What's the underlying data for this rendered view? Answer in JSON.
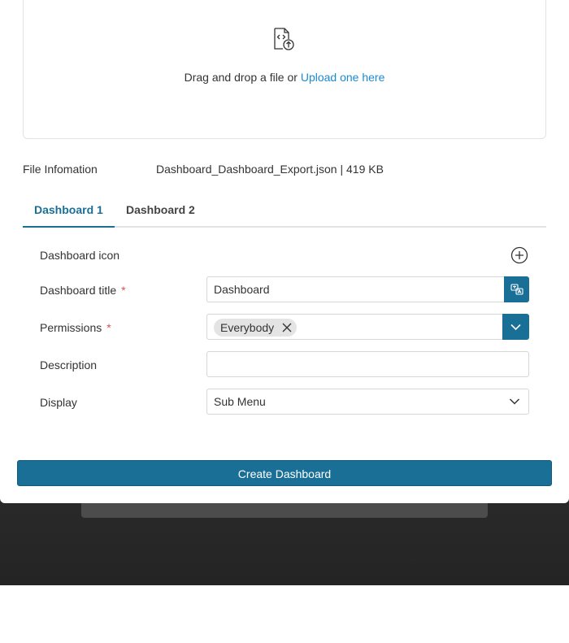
{
  "upload": {
    "prompt": "Drag and drop a file or ",
    "link": "Upload one here"
  },
  "file_info": {
    "label": "File Infomation",
    "value": "Dashboard_Dashboard_Export.json | 419 KB"
  },
  "tabs": [
    {
      "label": "Dashboard 1",
      "active": true
    },
    {
      "label": "Dashboard 2",
      "active": false
    }
  ],
  "form": {
    "icon_label": "Dashboard icon",
    "title_label": "Dashboard title",
    "title_value": "Dashboard",
    "permissions_label": "Permissions",
    "permissions_chip": "Everybody",
    "description_label": "Description",
    "description_value": "",
    "display_label": "Display",
    "display_value": "Sub Menu",
    "required_mark": "*"
  },
  "actions": {
    "create_label": "Create Dashboard"
  },
  "colors": {
    "primary": "#1a6f96",
    "link": "#1a8ad4",
    "required": "#d9534f"
  }
}
